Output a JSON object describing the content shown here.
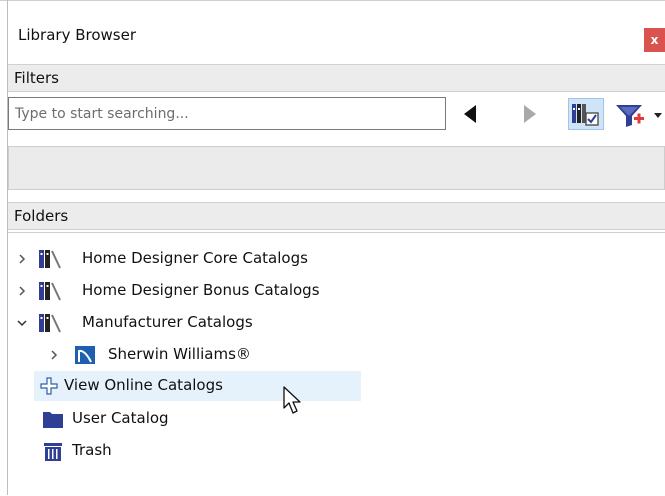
{
  "window": {
    "title": "Library Browser",
    "close_label": "x"
  },
  "filters": {
    "header": "Filters",
    "search_placeholder": "Type to start searching...",
    "search_value": ""
  },
  "folders": {
    "header": "Folders",
    "items": [
      {
        "label": "Home Designer Core Catalogs"
      },
      {
        "label": "Home Designer Bonus Catalogs"
      },
      {
        "label": "Manufacturer Catalogs"
      },
      {
        "label": "Sherwin Williams®"
      },
      {
        "label": "View Online Catalogs"
      },
      {
        "label": "User Catalog"
      },
      {
        "label": "Trash"
      }
    ]
  },
  "colors": {
    "accent": "#2f3f93",
    "close": "#d9534f",
    "hover": "#e5f1fb",
    "header_bg": "#ececec"
  }
}
